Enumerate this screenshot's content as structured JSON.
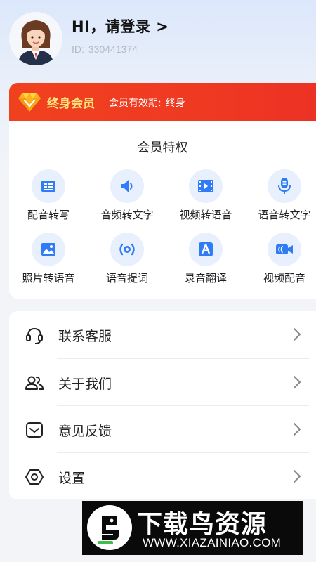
{
  "header": {
    "greeting": "HI，请登录 >",
    "id_label": "ID:",
    "id_value": "330441374"
  },
  "vip": {
    "title": "终身会员",
    "validity_label": "会员有效期:",
    "validity_value": "终身",
    "privileges_title": "会员特权",
    "privileges": [
      {
        "label": "配音转写",
        "icon": "text-card-icon"
      },
      {
        "label": "音频转文字",
        "icon": "speaker-icon"
      },
      {
        "label": "视频转语音",
        "icon": "film-play-icon"
      },
      {
        "label": "语音转文字",
        "icon": "microphone-icon"
      },
      {
        "label": "照片转语音",
        "icon": "image-icon"
      },
      {
        "label": "语音提词",
        "icon": "sound-wave-icon"
      },
      {
        "label": "录音翻译",
        "icon": "translate-a-icon"
      },
      {
        "label": "视频配音",
        "icon": "video-camera-icon"
      }
    ]
  },
  "menu": {
    "items": [
      {
        "label": "联系客服",
        "icon": "headset-icon"
      },
      {
        "label": "关于我们",
        "icon": "users-icon"
      },
      {
        "label": "意见反馈",
        "icon": "feedback-icon"
      },
      {
        "label": "设置",
        "icon": "settings-hexagon-icon"
      }
    ]
  },
  "watermark": {
    "title": "下载鸟资源",
    "url": "WWW.XIAZAINIAO.COM"
  },
  "colors": {
    "accent_blue": "#2f7cf6",
    "banner_red": "#ef3a22",
    "vip_gold": "#ffe27a",
    "icon_bg": "#e8f0fd"
  }
}
